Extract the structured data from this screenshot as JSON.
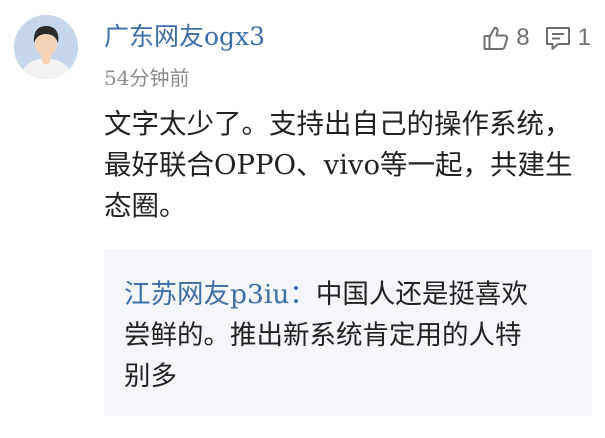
{
  "comment": {
    "avatar_icon": "default-user-avatar-icon",
    "username": "广东网友ogx3",
    "time": "54分钟前",
    "likes": "8",
    "replies": "1",
    "text": "文字太少了。支持出自己的操作系统，最好联合OPPO、vivo等一起，共建生态圈。"
  },
  "reply": {
    "author": "江苏网友p3iu：",
    "text": "中国人还是挺喜欢尝鲜的。推出新系统肯定用的人特别多"
  },
  "icons": {
    "like": "thumbs-up-icon",
    "reply": "comment-bubble-icon"
  },
  "colors": {
    "username": "#3d6ea7",
    "reply_background": "#f4f6fa",
    "avatar_background": "#c5d7e8"
  }
}
